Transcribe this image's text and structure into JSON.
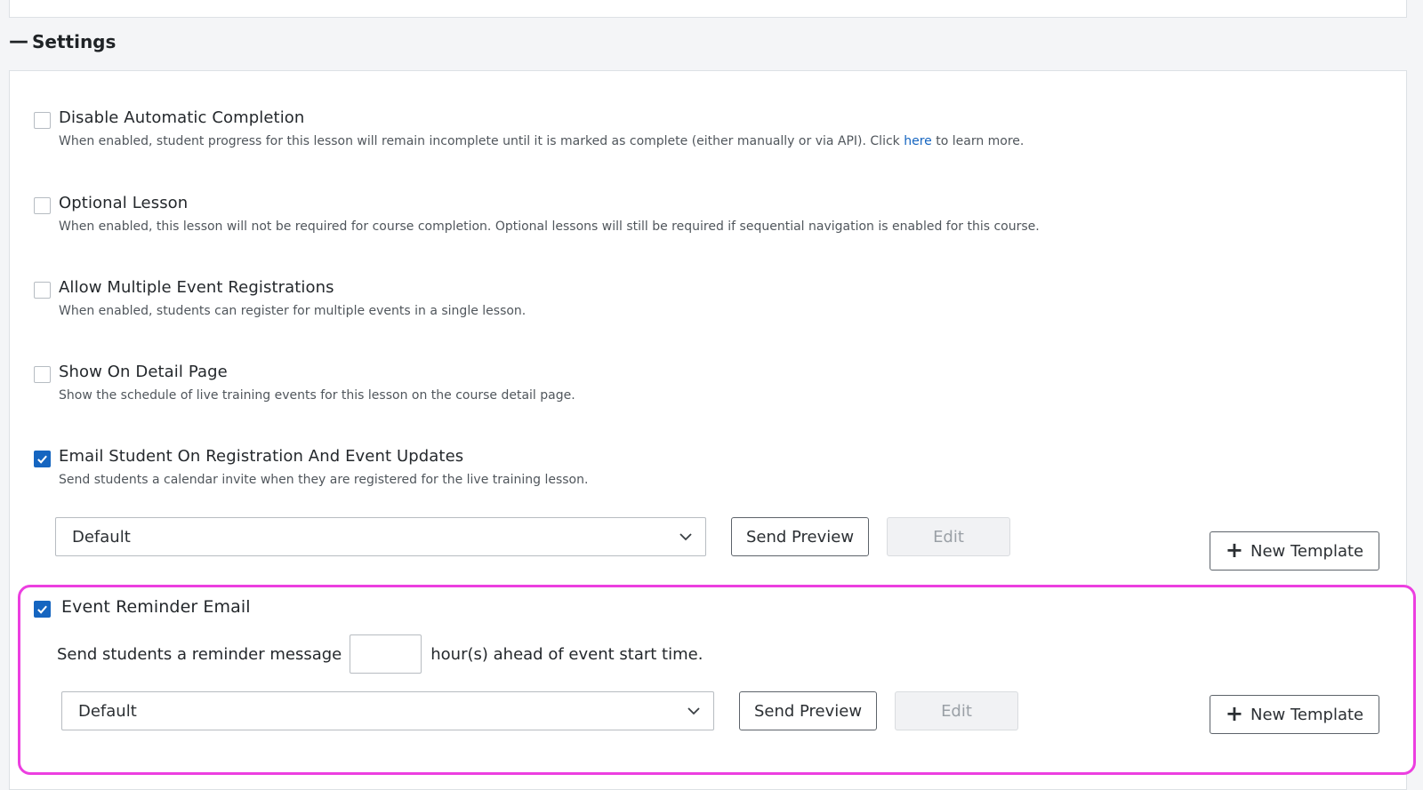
{
  "section": {
    "title": "Settings"
  },
  "settings": [
    {
      "title": "Disable Automatic Completion",
      "description_before": "When enabled, student progress for this lesson will remain incomplete until it is marked as complete (either manually or via API). Click ",
      "link_text": "here",
      "description_after": " to learn more.",
      "checked": false
    },
    {
      "title": "Optional Lesson",
      "description": "When enabled, this lesson will not be required for course completion. Optional lessons will still be required if sequential navigation is enabled for this course.",
      "checked": false
    },
    {
      "title": "Allow Multiple Event Registrations",
      "description": "When enabled, students can register for multiple events in a single lesson.",
      "checked": false
    },
    {
      "title": "Show On Detail Page",
      "description": "Show the schedule of live training events for this lesson on the course detail page.",
      "checked": false
    },
    {
      "title": "Email Student On Registration And Event Updates",
      "description": "Send students a calendar invite when they are registered for the live training lesson.",
      "checked": true
    }
  ],
  "registration_email": {
    "template_value": "Default",
    "send_preview_label": "Send Preview",
    "edit_label": "Edit",
    "new_template_label": "New Template"
  },
  "reminder_email": {
    "title": "Event Reminder Email",
    "checked": true,
    "text_before": "Send students a reminder message",
    "hours_value": "",
    "text_after": "hour(s) ahead of event start time.",
    "template_value": "Default",
    "send_preview_label": "Send Preview",
    "edit_label": "Edit",
    "new_template_label": "New Template"
  },
  "colors": {
    "accent": "#1565c0",
    "highlight": "#ec3fe0"
  }
}
